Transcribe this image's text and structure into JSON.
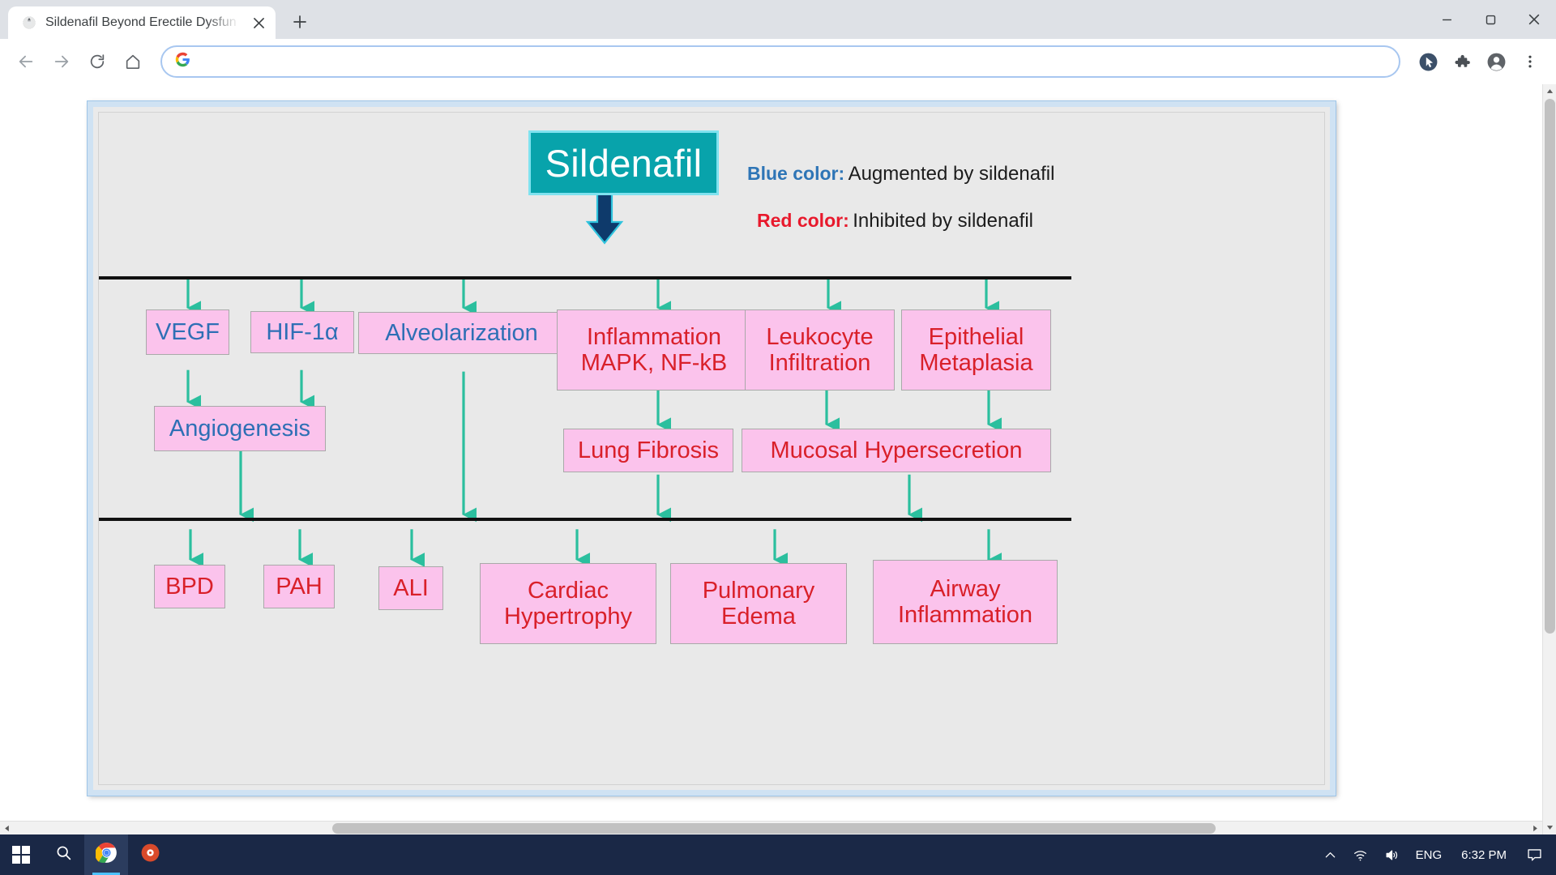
{
  "browser": {
    "tab": {
      "title": "Sildenafil Beyond Erectile Dysfun",
      "favicon_icon": "globe-icon",
      "close_icon": "×"
    },
    "new_tab_label": "+",
    "window_controls": {
      "minimize": "minimize-icon",
      "maximize": "maximize-icon",
      "close": "close-icon"
    },
    "toolbar": {
      "back_icon": "arrow-left-icon",
      "forward_icon": "arrow-right-icon",
      "reload_icon": "reload-icon",
      "home_icon": "home-icon",
      "search_engine_icon": "google-g-icon",
      "address_value": "",
      "address_placeholder": "",
      "cursor_icon": "cursor-badge-icon",
      "extensions_icon": "puzzle-piece-icon",
      "profile_icon": "account-avatar-icon",
      "menu_icon": "three-dot-menu-icon"
    }
  },
  "diagram": {
    "title": "Sildenafil",
    "legend": [
      {
        "key": "Blue color:",
        "value": "Augmented by sildenafil",
        "color": "#2e75b6"
      },
      {
        "key": "Red color:",
        "value": "Inhibited by sildenafil",
        "color": "#e8192c"
      }
    ],
    "nodes": {
      "vegf": "VEGF",
      "hif1a": "HIF-1α",
      "alveolarization": "Alveolarization",
      "inflammation": "Inflammation\nMAPK, NF-kB",
      "inflammation_l1": "Inflammation",
      "inflammation_l2": "MAPK, NF-kB",
      "leukocyte_l1": "Leukocyte",
      "leukocyte_l2": "Infiltration",
      "epithelial_l1": "Epithelial",
      "epithelial_l2": "Metaplasia",
      "angiogenesis": "Angiogenesis",
      "lung_fibrosis": "Lung Fibrosis",
      "mucosal": "Mucosal Hypersecretion",
      "bpd": "BPD",
      "pah": "PAH",
      "ali": "ALI",
      "cardiac_l1": "Cardiac",
      "cardiac_l2": "Hypertrophy",
      "pulmonary_l1": "Pulmonary",
      "pulmonary_l2": "Edema",
      "airway_l1": "Airway",
      "airway_l2": "Inflammation"
    },
    "colors": {
      "title_fill": "#08a3ab",
      "title_border": "#7fe2ef",
      "node_fill": "#fbc3ec",
      "node_border": "#a9a9a9",
      "blue_text": "#2e6fb5",
      "red_text": "#d9202a",
      "arrow_green": "#2bbf9e",
      "arrow_navy": "#0e3a6b",
      "divider": "#111111"
    }
  },
  "taskbar": {
    "start_icon": "windows-logo-icon",
    "search_icon": "search-icon",
    "apps": [
      {
        "name": "chrome-icon"
      },
      {
        "name": "media-player-icon"
      }
    ],
    "tray": {
      "chevron_up_icon": "chevron-up-icon",
      "wifi_icon": "wifi-icon",
      "volume_icon": "volume-icon",
      "language": "ENG",
      "clock": "6:32 PM",
      "notification_icon": "notification-icon"
    }
  }
}
